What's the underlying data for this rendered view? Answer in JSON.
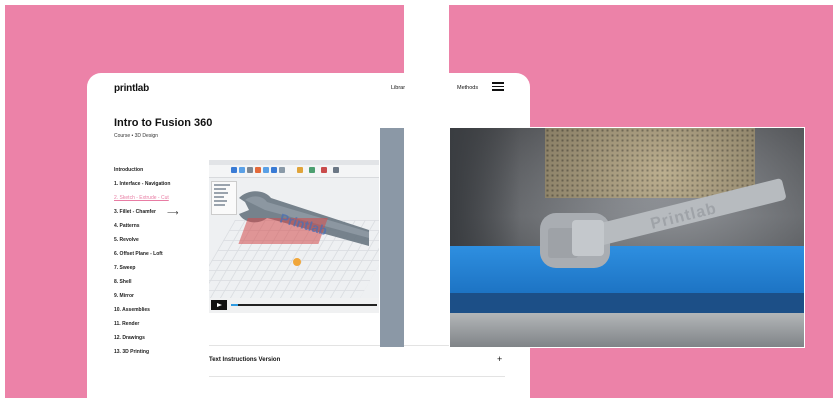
{
  "header": {
    "logo": "printlab",
    "nav_partial": "Librar",
    "nav_methods": "Methods"
  },
  "course": {
    "title": "Intro to Fusion 360",
    "subtitle": "Course • 3D Design"
  },
  "lessons": [
    {
      "label": "Introduction"
    },
    {
      "label": "1. Interface - Navigation"
    },
    {
      "label": "2. Sketch - Extrude - Cut",
      "active": true
    },
    {
      "label": "3. Fillet - Chamfer"
    },
    {
      "label": "4. Patterns"
    },
    {
      "label": "5. Revolve"
    },
    {
      "label": "6. Offset Plane - Loft"
    },
    {
      "label": "7. Sweep"
    },
    {
      "label": "8. Shell"
    },
    {
      "label": "9. Mirror"
    },
    {
      "label": "10. Assemblies"
    },
    {
      "label": "11. Render"
    },
    {
      "label": "12. Drawings"
    },
    {
      "label": "13. 3D Printing"
    }
  ],
  "video": {
    "progress": 0.05
  },
  "accordion": {
    "text_instructions": "Text Instructions Version",
    "toggle": "+"
  },
  "photo": {
    "embossed_text": "Printlab"
  },
  "colors": {
    "pink": "#ec82a8",
    "accent": "#e87ca3",
    "progress": "#2f9be2",
    "bed_blue": "#2e8fe0"
  }
}
